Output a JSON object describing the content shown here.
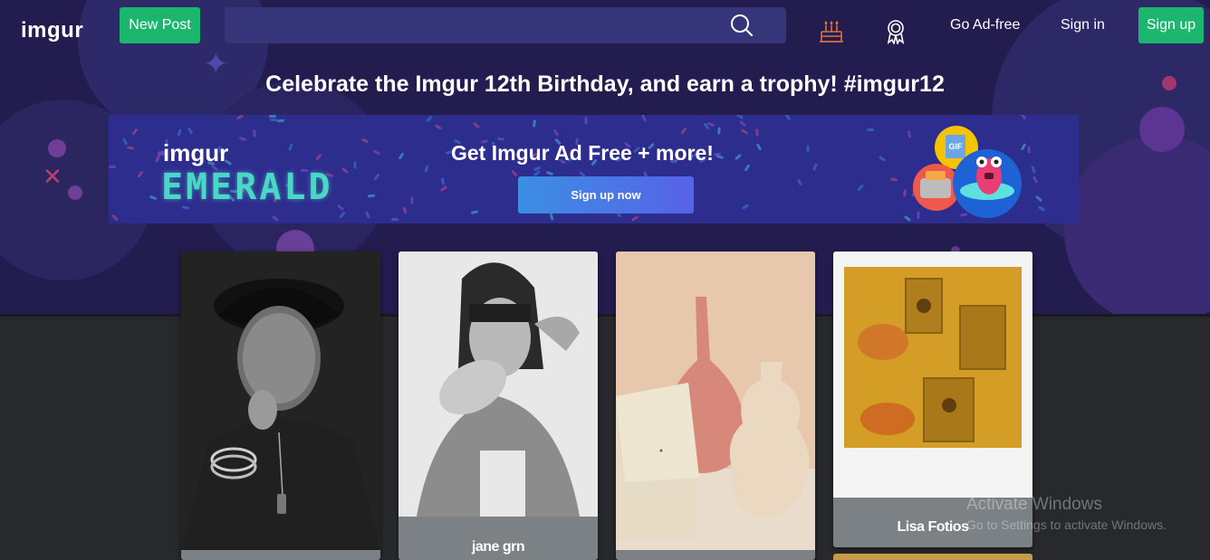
{
  "nav": {
    "logo": "imgur",
    "new_post": "New Post",
    "search_placeholder": "",
    "search_icon": "search-icon",
    "birthday_icon": "cake-icon",
    "trophy_icon": "trophy-icon",
    "go_ad_free": "Go Ad-free",
    "sign_in": "Sign in",
    "sign_up": "Sign up",
    "colors": {
      "green": "#1bb76e",
      "nav_bg": "#231c4f"
    }
  },
  "headline": "Celebrate the Imgur 12th Birthday, and earn a trophy! #imgur12",
  "banner": {
    "brand_small": "imgur",
    "brand_big": "EMERALD",
    "title": "Get Imgur Ad Free + more!",
    "cta": "Sign up now",
    "art_badge": "GIF",
    "colors": {
      "emerald": "#4ad7c6",
      "bg": "#2d2d8e"
    }
  },
  "posts": [
    {
      "title": "",
      "image": "portrait-black-and-white-man-in-cap"
    },
    {
      "title": "jane grn",
      "image": "portrait-black-and-white-woman-hand"
    },
    {
      "title": "",
      "image": "still-life-vases"
    },
    {
      "title": "Lisa Fotios",
      "image": "polaroid-golden-flowers"
    }
  ],
  "watermark": {
    "line1": "Activate Windows",
    "line2": "Go to Settings to activate Windows."
  }
}
